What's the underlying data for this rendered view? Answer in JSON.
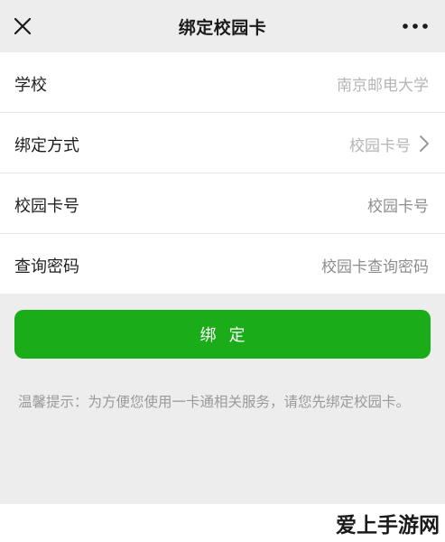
{
  "nav": {
    "title": "绑定校园卡",
    "close_icon": "close-icon",
    "more_icon": "more-dots-icon"
  },
  "form": {
    "rows": [
      {
        "label": "学校",
        "value": "南京邮电大学"
      },
      {
        "label": "绑定方式",
        "value": "校园卡号"
      },
      {
        "label": "校园卡号",
        "value": "校园卡号"
      },
      {
        "label": "查询密码",
        "value": "校园卡查询密码"
      }
    ]
  },
  "bind_button": {
    "label": "绑定"
  },
  "tip": {
    "text": "温馨提示：为方便您使用一卡通相关服务，请您先绑定校园卡。"
  },
  "watermark": {
    "text": "爱上手游网"
  },
  "colors": {
    "accent": "#1aad19",
    "background": "#ededed"
  }
}
